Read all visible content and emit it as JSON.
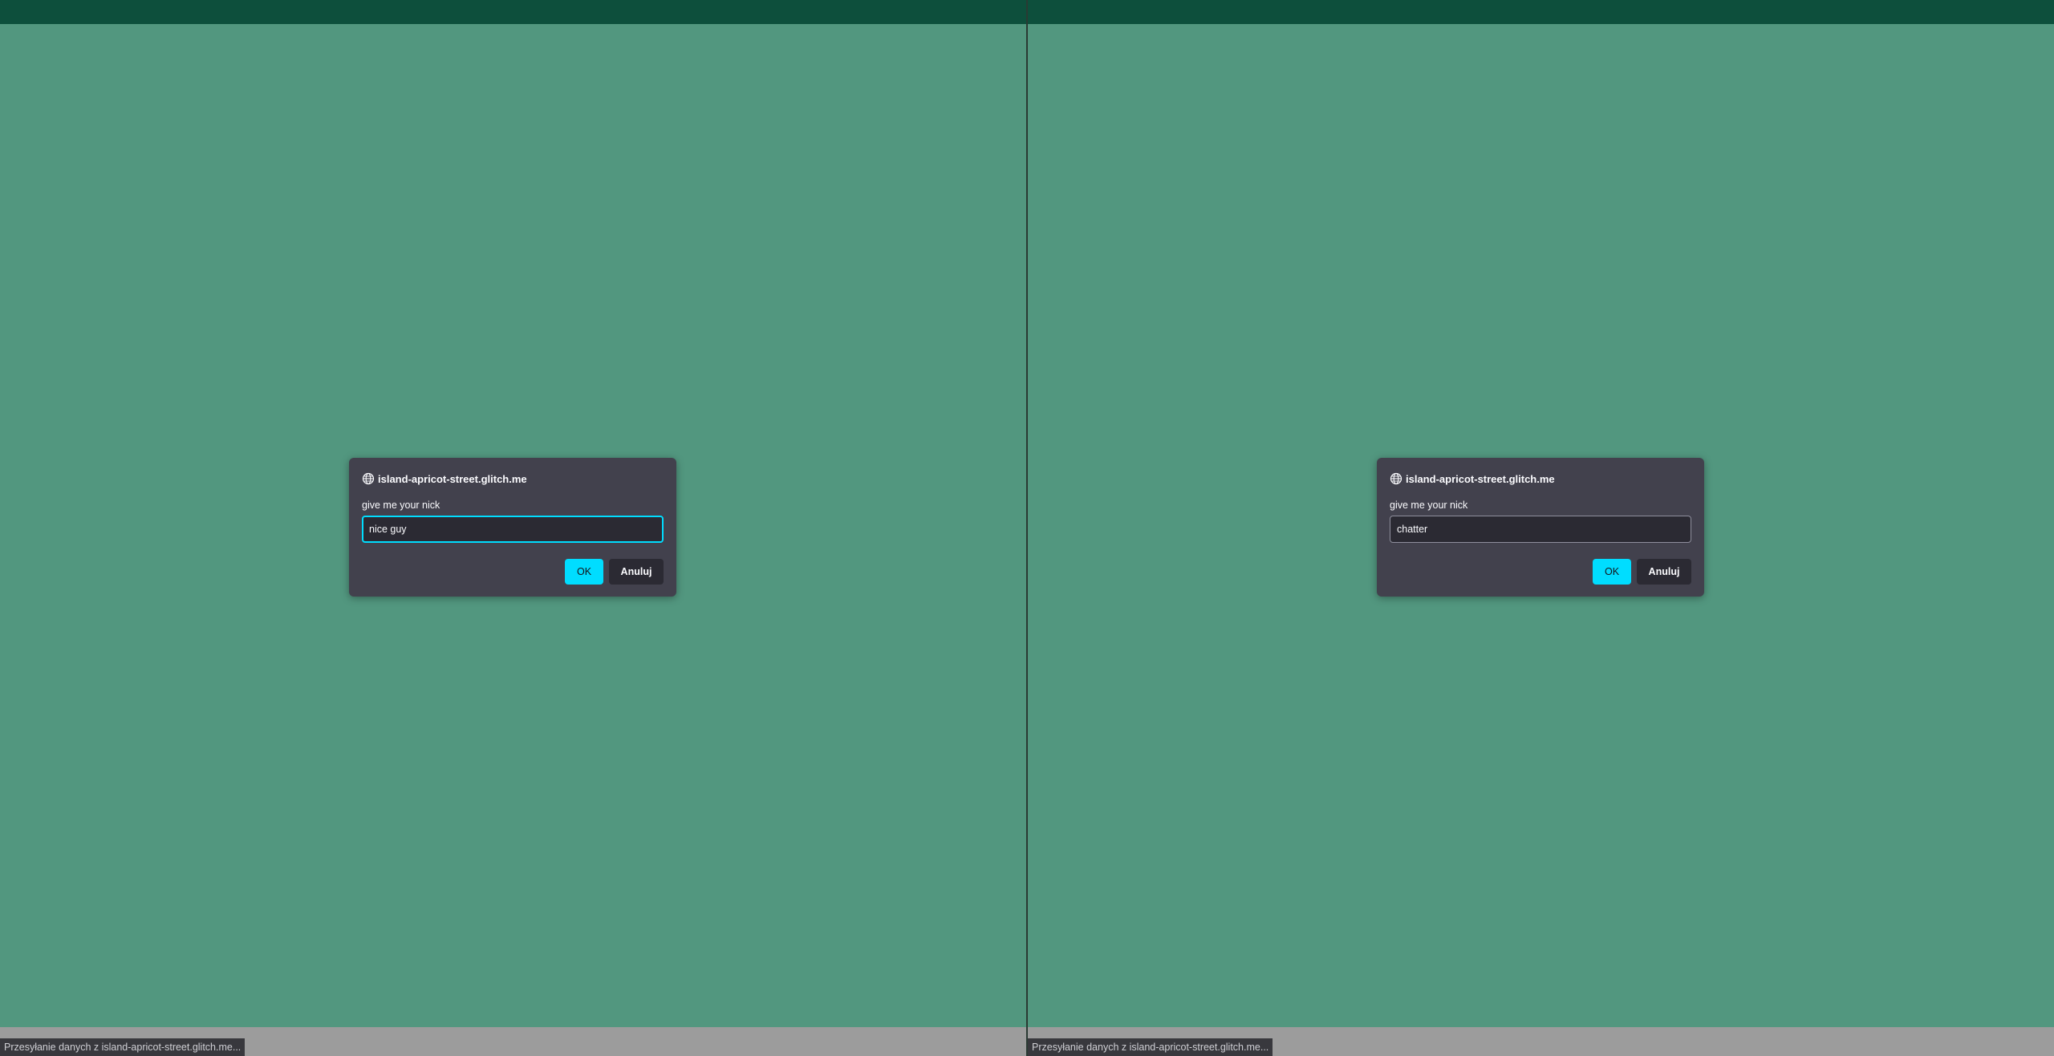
{
  "left_window": {
    "dialog": {
      "origin": "island-apricot-street.glitch.me",
      "message": "give me your nick",
      "input_value": "nice guy",
      "ok_label": "OK",
      "cancel_label": "Anuluj"
    },
    "status_text": "Przesyłanie danych z island-apricot-street.glitch.me..."
  },
  "right_window": {
    "dialog": {
      "origin": "island-apricot-street.glitch.me",
      "message": "give me your nick",
      "input_value": "chatter",
      "ok_label": "OK",
      "cancel_label": "Anuluj"
    },
    "status_text": "Przesyłanie danych z island-apricot-street.glitch.me..."
  },
  "colors": {
    "page_background": "#52977f",
    "top_bar": "#0d4f3c",
    "dialog_background": "#42414d",
    "accent": "#00ddff",
    "input_background": "#2b2a33",
    "bottom_bar": "#9c9c9c"
  },
  "icons": {
    "dialog_origin_icon": "globe-icon"
  }
}
